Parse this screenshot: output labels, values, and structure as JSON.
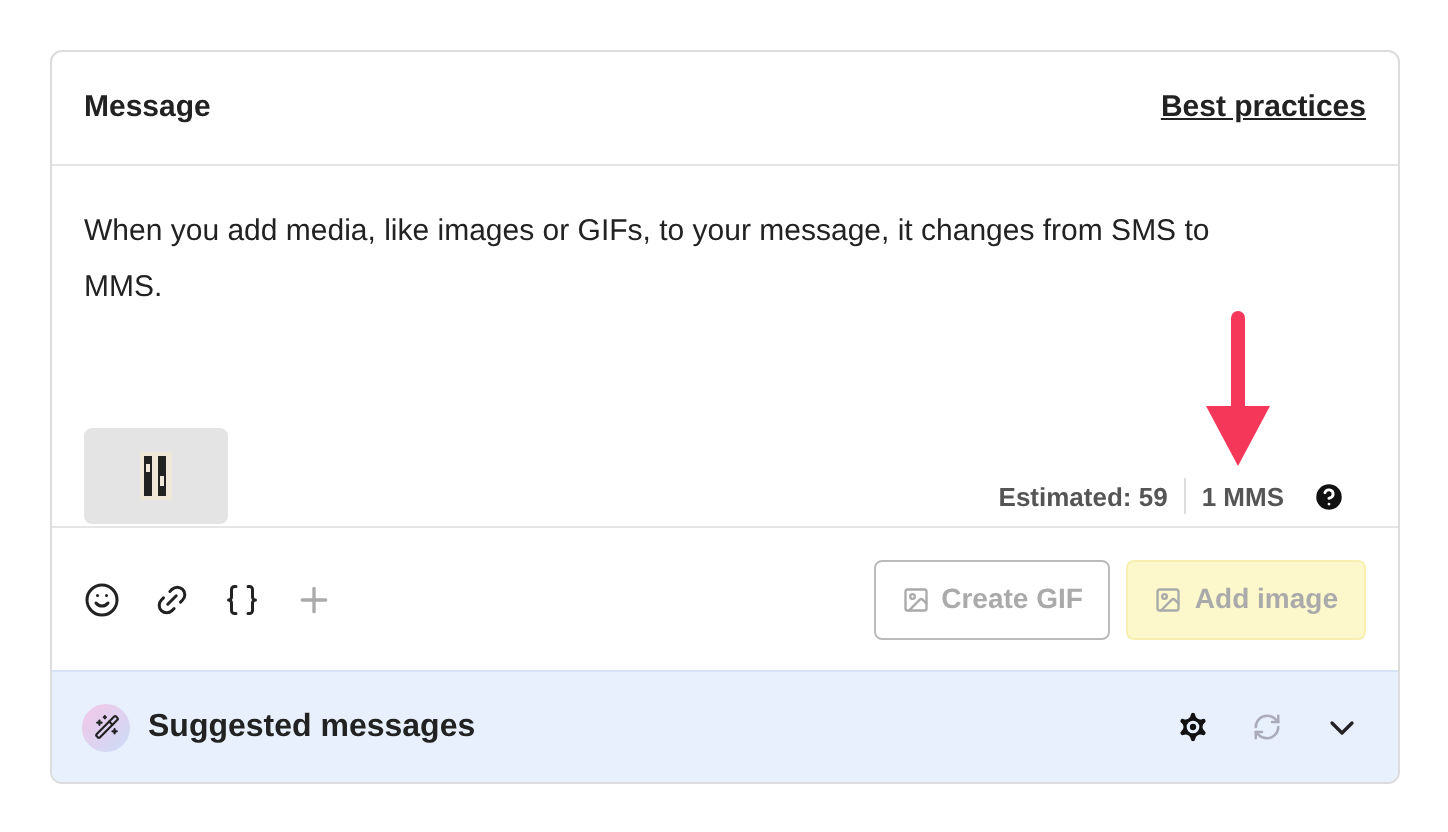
{
  "header": {
    "title": "Message",
    "link": "Best practices"
  },
  "message": {
    "value": "When you add media, like images or GIFs, to your message, it changes from SMS to MMS."
  },
  "counter": {
    "estimated": "Estimated: 59",
    "segments": "1 MMS"
  },
  "toolbar": {
    "buttons": [
      {
        "label": "Create GIF",
        "kind": "outline",
        "disabled": true
      },
      {
        "label": "Add image",
        "kind": "primary",
        "disabled": true
      }
    ]
  },
  "suggested": {
    "title": "Suggested messages",
    "refresh_disabled": true,
    "expanded": false
  }
}
